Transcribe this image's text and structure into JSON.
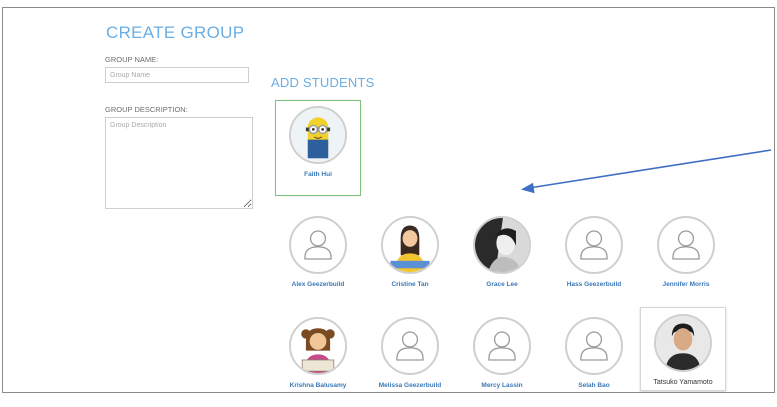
{
  "page": {
    "title": "CREATE GROUP"
  },
  "form": {
    "group_name_label": "GROUP NAME:",
    "group_name_placeholder": "Group Name",
    "group_description_label": "GROUP DESCRIPTION:",
    "group_description_placeholder": "Group Description"
  },
  "students_section": {
    "title": "ADD STUDENTS"
  },
  "selected_student": {
    "name": "Faith Hui",
    "icon": "minion-avatar-icon"
  },
  "students_row1": [
    {
      "name": "Alex Geezerbuild",
      "icon": "default-user-avatar-icon"
    },
    {
      "name": "Cristine Tan",
      "icon": "cartoon-girl-avatar-icon"
    },
    {
      "name": "Grace Lee",
      "icon": "photo-avatar-icon"
    },
    {
      "name": "Hass Geezerbuild",
      "icon": "default-user-avatar-icon"
    },
    {
      "name": "Jennifer Morris",
      "icon": "default-user-avatar-icon"
    }
  ],
  "students_row2": [
    {
      "name": "Krishna Balusamy",
      "icon": "cartoon-child-avatar-icon"
    },
    {
      "name": "Melissa Geezerbuild",
      "icon": "default-user-avatar-icon"
    },
    {
      "name": "Mercy Lassin",
      "icon": "default-user-avatar-icon"
    },
    {
      "name": "Selah Bao",
      "icon": "default-user-avatar-icon"
    },
    {
      "name": "Tatsuko Yamamoto",
      "icon": "photo-avatar-icon"
    }
  ],
  "colors": {
    "accent": "#6aaee4",
    "selected_border": "#7cc17a",
    "name_link": "#3a78b8",
    "arrow": "#3f6fc4"
  }
}
